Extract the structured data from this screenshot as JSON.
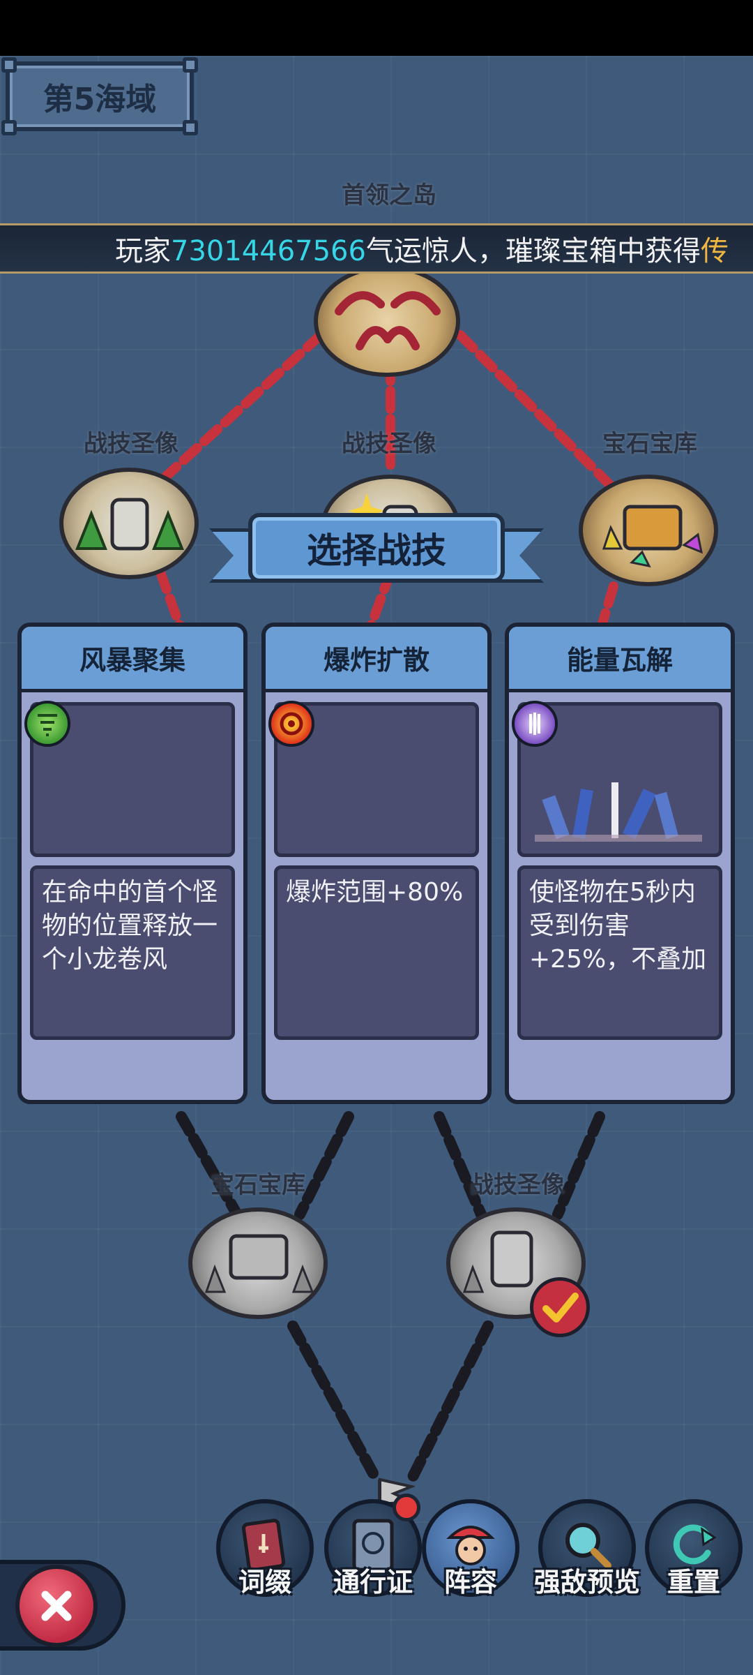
{
  "header": {
    "sea_area": "第5海域"
  },
  "map": {
    "islands": [
      {
        "id": "boss",
        "label": "首领之岛"
      },
      {
        "id": "statue-left",
        "label": "战技圣像"
      },
      {
        "id": "statue-center",
        "label": "战技圣像"
      },
      {
        "id": "gem-vault-right",
        "label": "宝石宝库"
      },
      {
        "id": "gem-vault-lower",
        "label": "宝石宝库"
      },
      {
        "id": "statue-lower",
        "label": "战技圣像"
      }
    ]
  },
  "ticker": {
    "prefix": "玩家",
    "player_id": "73014467566",
    "message": "气运惊人，璀璨宝箱中获得",
    "tail": "传"
  },
  "dialog": {
    "title": "选择战技",
    "cards": [
      {
        "name": "风暴聚集",
        "icon": "tornado-icon",
        "description": "在命中的首个怪物的位置释放一个小龙卷风"
      },
      {
        "name": "爆炸扩散",
        "icon": "explosion-icon",
        "description": "爆炸范围+80%"
      },
      {
        "name": "能量瓦解",
        "icon": "energy-icon",
        "description": "使怪物在5秒内受到伤害+25%，不叠加"
      }
    ]
  },
  "toolbar": {
    "items": [
      {
        "label": "词缀",
        "icon": "card-icon"
      },
      {
        "label": "通行证",
        "icon": "passport-icon",
        "badge": true
      },
      {
        "label": "阵容",
        "icon": "pirate-icon",
        "active": true
      },
      {
        "label": "强敌预览",
        "icon": "magnifier-icon"
      },
      {
        "label": "重置",
        "icon": "refresh-icon"
      }
    ]
  },
  "colors": {
    "sea": "#3f5a7a",
    "card_header": "#6a9ed4",
    "card_body": "#9aa4cf",
    "ticker_number": "#37d6e6",
    "ticker_tail": "#f0b840"
  }
}
